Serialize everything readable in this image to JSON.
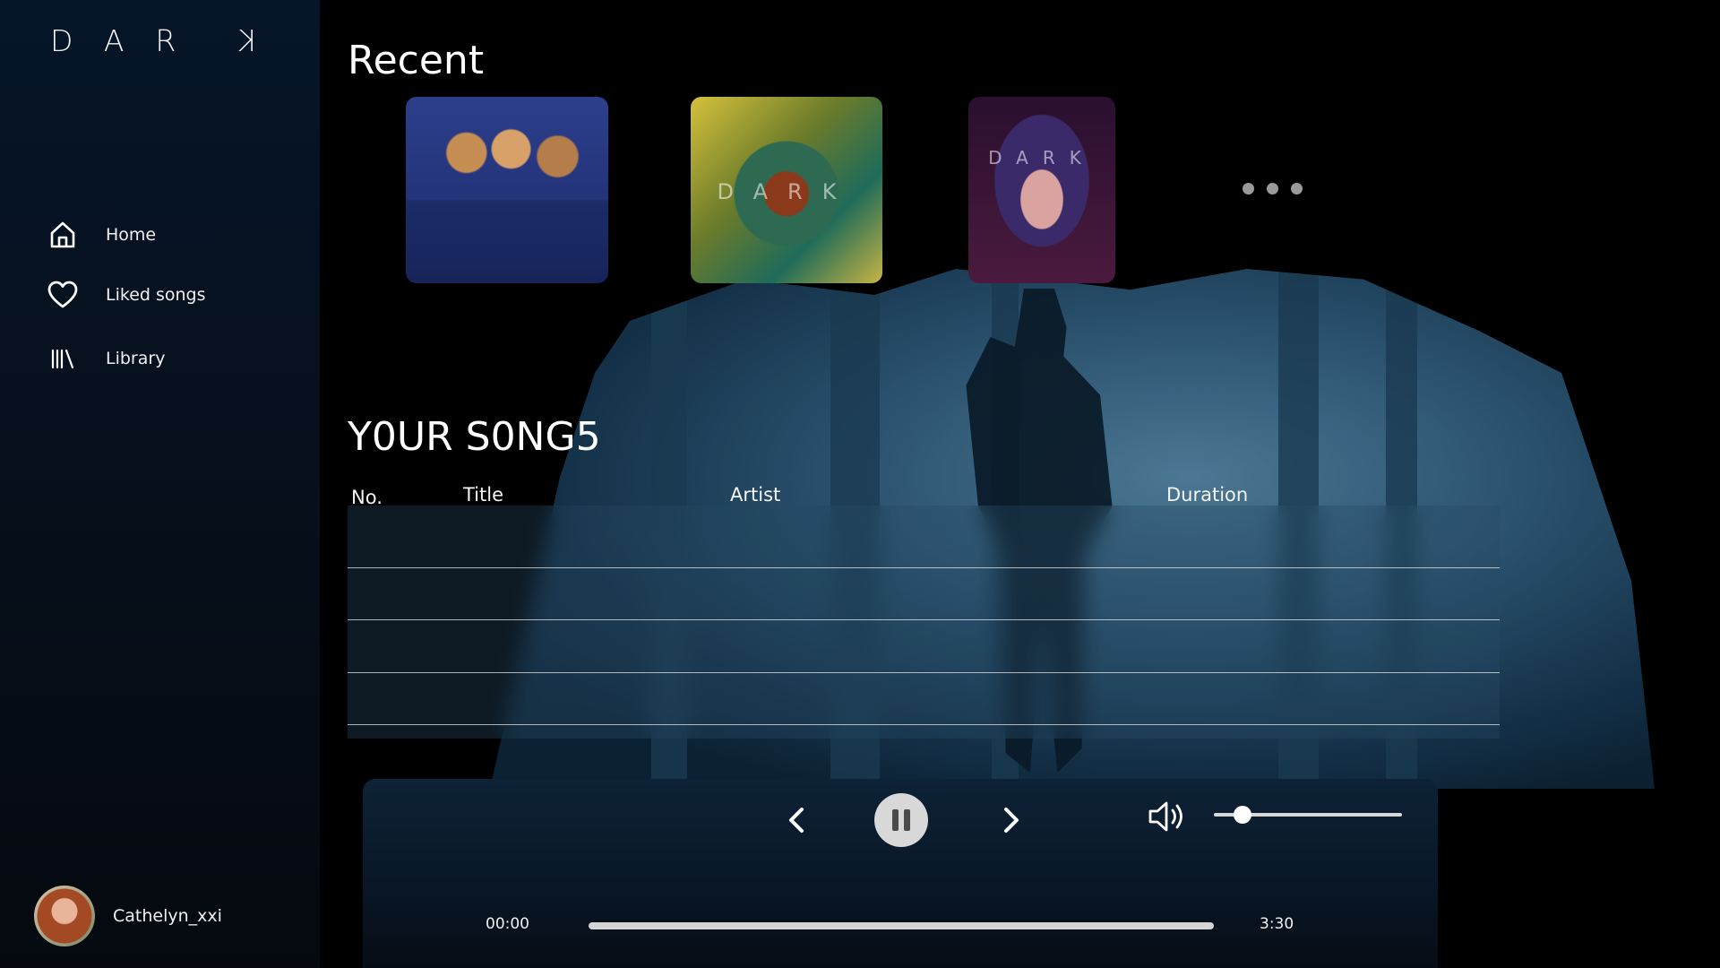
{
  "app": {
    "logo_letters": [
      "D",
      "A",
      "R",
      "K"
    ]
  },
  "sidebar": {
    "items": [
      {
        "label": "Home",
        "icon": "home-icon"
      },
      {
        "label": "Liked songs",
        "icon": "heart-icon"
      },
      {
        "label": "Library",
        "icon": "library-icon"
      }
    ],
    "user": {
      "name": "Cathelyn_xxi",
      "icon": "avatar"
    }
  },
  "recent": {
    "title": "Recent",
    "albums": [
      {
        "cover_text": ""
      },
      {
        "cover_text": "DARK"
      },
      {
        "cover_text": "DARK"
      }
    ],
    "more_icon": "more-dots-icon"
  },
  "songs": {
    "title": "Y0UR S0NG5",
    "columns": [
      "No.",
      "Title",
      "Artist",
      "Duration"
    ],
    "rows": []
  },
  "player": {
    "current_time": "00:00",
    "total_time": "3:30",
    "progress": 0,
    "volume": 0.15,
    "state": "playing",
    "icons": [
      "chevron-left-icon",
      "pause-icon",
      "chevron-right-icon",
      "volume-icon"
    ]
  },
  "colors": {
    "sidebar_bg": "#061529",
    "player_bg": "#0d2236",
    "control": "#d8d8d8"
  }
}
